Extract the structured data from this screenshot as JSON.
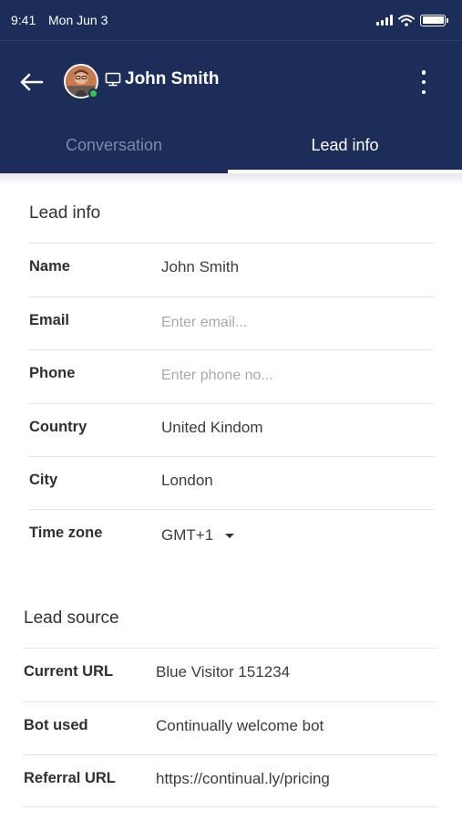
{
  "status_bar": {
    "time": "9:41",
    "date": "Mon Jun 3"
  },
  "header": {
    "contact_name": "John Smith"
  },
  "tabs": [
    {
      "label": "Conversation",
      "active": false
    },
    {
      "label": "Lead info",
      "active": true
    }
  ],
  "lead_info": {
    "title": "Lead info",
    "name": {
      "label": "Name",
      "value": "John Smith"
    },
    "email": {
      "label": "Email",
      "value": "",
      "placeholder": "Enter email..."
    },
    "phone": {
      "label": "Phone",
      "value": "",
      "placeholder": "Enter phone no..."
    },
    "country": {
      "label": "Country",
      "value": "United Kindom"
    },
    "city": {
      "label": "City",
      "value": "London"
    },
    "timezone": {
      "label": "Time zone",
      "value": "GMT+1"
    }
  },
  "lead_source": {
    "title": "Lead source",
    "current_url": {
      "label": "Current URL",
      "value": "Blue Visitor 151234"
    },
    "bot_used": {
      "label": "Bot used",
      "value": "Continually welcome bot"
    },
    "referral_url": {
      "label": "Referral URL",
      "value": "https://continual.ly/pricing"
    }
  },
  "colors": {
    "header_bg": "#1c2d5a",
    "online": "#39c24e",
    "inactive_tab": "#7d8aa8"
  },
  "icons": [
    "back-arrow-icon",
    "monitor-icon",
    "more-vertical-icon",
    "signal-icon",
    "wifi-icon",
    "battery-icon",
    "dropdown-caret-icon"
  ]
}
